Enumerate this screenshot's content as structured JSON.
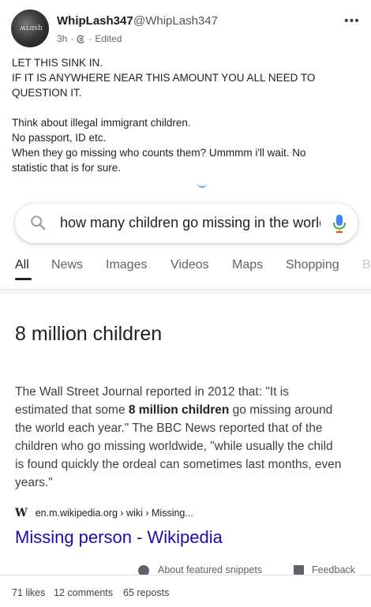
{
  "post": {
    "author_name": "WhipLash347",
    "author_handle": "@WhipLash347",
    "time": "3h",
    "edited": "Edited",
    "lines": [
      "LET THIS SINK IN.",
      "IF IT IS ANYWHERE NEAR THIS AMOUNT YOU ALL NEED TO",
      "QUESTION IT.",
      "",
      "Think about illegal immigrant children.",
      "No passport, ID etc.",
      "When they go missing who counts them? Ummmm i'll wait. No",
      "statistic that is for sure."
    ]
  },
  "search": {
    "query": "how many children go missing in the world",
    "tabs": [
      "All",
      "News",
      "Images",
      "Videos",
      "Maps",
      "Shopping",
      "B"
    ],
    "answer": "8 million children",
    "snippet_lines": [
      [
        "The Wall Street Journal reported in 2012 that: \"It is",
        "",
        ""
      ],
      [
        "estimated that some ",
        "8 million children",
        " go missing around"
      ],
      [
        "the world each year.\" The BBC News reported that of the",
        "",
        ""
      ],
      [
        "children who go missing worldwide, \"while usually the child",
        "",
        ""
      ],
      [
        "is found quickly the ordeal can sometimes last months, even",
        "",
        ""
      ],
      [
        "years.\"",
        "",
        ""
      ]
    ],
    "source_icon": "W",
    "source_url": "en.m.wikipedia.org › wiki › Missing...",
    "result_title": "Missing person - Wikipedia",
    "about": "About featured snippets",
    "feedback": "Feedback"
  },
  "stats": {
    "likes": "71 likes",
    "comments": "12 comments",
    "reposts": "65 reposts"
  },
  "colors": {
    "link": "#1a0dab",
    "accent_blue": "#4285f4"
  }
}
